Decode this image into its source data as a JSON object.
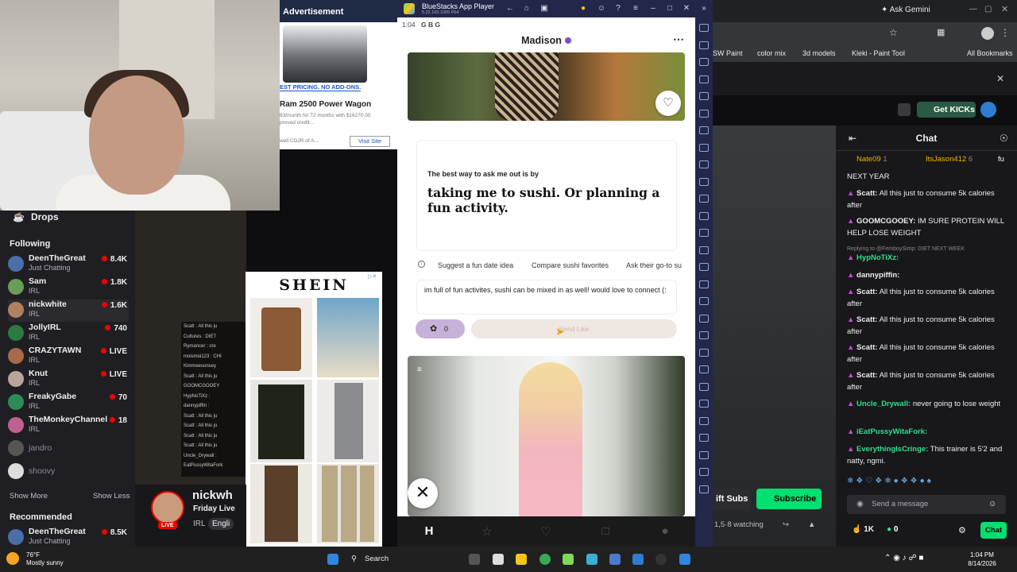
{
  "webcam": {
    "label": "streamer-webcam"
  },
  "sidebar": {
    "drops_label": "Drops",
    "following_title": "Following",
    "recommended_title": "Recommended",
    "show_more": "Show More",
    "show_less": "Show Less",
    "channels": [
      {
        "name": "DeenTheGreat",
        "game": "Just Chatting",
        "viewers": "8.4K",
        "color": "#4a6ea8"
      },
      {
        "name": "Sam",
        "game": "IRL",
        "viewers": "1.8K",
        "color": "#6a9c5a"
      },
      {
        "name": "nickwhite",
        "game": "IRL",
        "viewers": "1.6K",
        "color": "#b08060"
      },
      {
        "name": "JollyIRL",
        "game": "IRL",
        "viewers": "740",
        "color": "#2b7a3f"
      },
      {
        "name": "CRAZYTAWN",
        "game": "IRL",
        "viewers": "LIVE",
        "color": "#a86a4a"
      },
      {
        "name": "Knut",
        "game": "IRL",
        "viewers": "LIVE",
        "color": "#b9a59a"
      },
      {
        "name": "FreakyGabe",
        "game": "IRL",
        "viewers": "70",
        "color": "#2e8b57"
      },
      {
        "name": "TheMonkeyChannel",
        "game": "IRL",
        "viewers": "18",
        "color": "#c06090"
      },
      {
        "name": "jandro",
        "game": "",
        "viewers": "",
        "color": "#555"
      },
      {
        "name": "shoovy",
        "game": "",
        "viewers": "",
        "color": "#ddd"
      }
    ],
    "recommended": [
      {
        "name": "DeenTheGreat",
        "game": "Just Chatting",
        "viewers": "8.5K",
        "color": "#4a6ea8"
      }
    ]
  },
  "minichat": [
    "Scatt : All this ju",
    "Cultures : DIET",
    "Rymancer : cre",
    "moismoi123 : CHI",
    "Kimmeesonsey",
    "Scatt : All this ju",
    "GOOMCGOOEY",
    "HypNoTiXz :",
    "dannypiffin :",
    "Scatt : All this ju",
    "Scatt : All this ju",
    "Scatt : All this ju",
    "Scatt : All this ju",
    "Uncle_Drywall :",
    "EatPussyWitaFork"
  ],
  "ad": {
    "label": "Advertisement",
    "pricing": "EST PRICING. NO ADD-ONS.",
    "title": "Ram 2500 Power Wagon",
    "desc": "63/month for 72 months with $16270.00 proved credit...",
    "dealer": "well CDJR of A...",
    "visit": "Visit Site"
  },
  "shein": {
    "logo": "SHEIN"
  },
  "streamer": {
    "name": "nickwh",
    "title": "Friday Live",
    "category": "IRL",
    "tag": "Engli",
    "live": "LIVE"
  },
  "bluestacks": {
    "title": "BlueStacks App Player",
    "version": "5.22.100.1005 P64",
    "status_time": "1:04",
    "status_icons": "G  B  G"
  },
  "hinge": {
    "profile_name": "Madison",
    "more": "⋯",
    "prompt_question": "The best way to ask me out is by",
    "prompt_answer": "taking me to sushi. Or planning a fun activity.",
    "suggestions": [
      "Suggest a fun date idea",
      "Compare sushi favorites",
      "Ask their go-to su"
    ],
    "comment": "im full of fun activites, sushi can be mixed in as well! would love to connect (:",
    "rose_count": "0",
    "send_label": "Send Like"
  },
  "chrome": {
    "ask_gemini": "Ask Gemini",
    "bookmarks": [
      "SW Paint",
      "color mix",
      "3d models",
      "Kleki - Paint Tool",
      "All Bookmarks"
    ]
  },
  "twitch": {
    "get_kicks": "Get KICKs",
    "chat_title": "Chat",
    "top_chatters": [
      "Nate09",
      "1",
      "ItsJason412",
      "6",
      "fu"
    ],
    "messages": [
      {
        "user": "",
        "text": "NEXT YEAR",
        "color": "#efeff1"
      },
      {
        "user": "Scatt:",
        "text": "All this just to consume 5k calories after",
        "color": "#efeff1"
      },
      {
        "user": "GOOMCGOOEY:",
        "text": "IM SURE PROTEIN WILL HELP LOSE WEIGHT",
        "color": "#efeff1"
      },
      {
        "user": "HypNoTiXz:",
        "text": "",
        "color": "#2ee08a",
        "reply": "Replying to @FemboySimp: DIET NEXT WEEK"
      },
      {
        "user": "dannypiffin:",
        "text": "",
        "color": "#efeff1"
      },
      {
        "user": "Scatt:",
        "text": "All this just to consume 5k calories after",
        "color": "#efeff1"
      },
      {
        "user": "Scatt:",
        "text": "All this just to consume 5k calories after",
        "color": "#efeff1"
      },
      {
        "user": "Scatt:",
        "text": "All this just to consume 5k calories after",
        "color": "#efeff1"
      },
      {
        "user": "Scatt:",
        "text": "All this just to consume 5k calories after",
        "color": "#efeff1"
      },
      {
        "user": "Uncle_Drywall:",
        "text": "never going to lose weight",
        "color": "#2ee08a"
      },
      {
        "user": "iEatPussyWitaFork:",
        "text": "",
        "color": "#2ee08a"
      },
      {
        "user": "EverythingIsCringe:",
        "text": "This trainer is 5'2 and natty, ngmi.",
        "color": "#2ee08a"
      }
    ],
    "gift_subs": "ift Subs",
    "subscribe": "Subscribe",
    "send_placeholder": "Send a message",
    "watching": "1,5·8 watching",
    "likes": "1K",
    "kicks": "0",
    "chat_btn": "Chat"
  },
  "taskbar": {
    "temp": "76°F",
    "weather": "Mostly sunny",
    "search": "Search",
    "time": "1:04 PM",
    "date": "8/14/2026"
  }
}
